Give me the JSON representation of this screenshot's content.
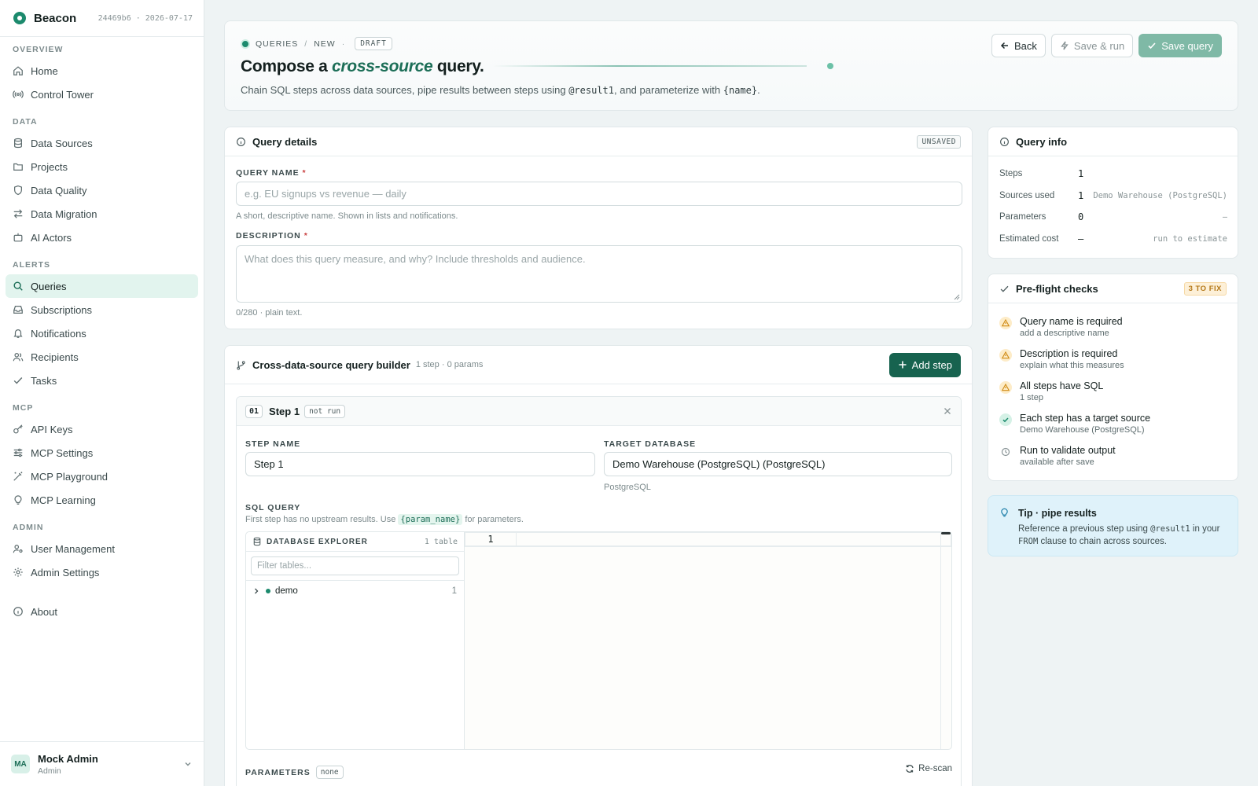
{
  "brand": {
    "name": "Beacon",
    "meta": "24469b6 · 2026-07-17"
  },
  "nav": {
    "sections": {
      "overview": "OVERVIEW",
      "data": "DATA",
      "alerts": "ALERTS",
      "mcp": "MCP",
      "admin": "ADMIN"
    },
    "items": {
      "home": "Home",
      "control_tower": "Control Tower",
      "data_sources": "Data Sources",
      "projects": "Projects",
      "data_quality": "Data Quality",
      "data_migration": "Data Migration",
      "ai_actors": "AI Actors",
      "queries": "Queries",
      "subscriptions": "Subscriptions",
      "notifications": "Notifications",
      "recipients": "Recipients",
      "tasks": "Tasks",
      "api_keys": "API Keys",
      "mcp_settings": "MCP Settings",
      "mcp_playground": "MCP Playground",
      "mcp_learning": "MCP Learning",
      "user_management": "User Management",
      "admin_settings": "Admin Settings",
      "about": "About"
    }
  },
  "user": {
    "initials": "MA",
    "name": "Mock Admin",
    "role": "Admin"
  },
  "hero": {
    "crumb_queries": "QUERIES",
    "crumb_sep": "/",
    "crumb_new": "NEW",
    "crumb_dot": "·",
    "crumb_draft": "DRAFT",
    "title_prefix": "Compose a",
    "title_em": "cross-source",
    "title_suffix": "query.",
    "sub_1": "Chain SQL steps across data sources, pipe results between steps using",
    "sub_code_1": "@result1",
    "sub_2": ", and parameterize with",
    "sub_code_2": "{name}",
    "sub_3": ".",
    "back": "Back",
    "save_run": "Save & run",
    "save_query": "Save query"
  },
  "details": {
    "title": "Query details",
    "badge": "UNSAVED",
    "name_label": "QUERY NAME",
    "required": "*",
    "name_placeholder": "e.g. EU signups vs revenue — daily",
    "name_hint": "A short, descriptive name. Shown in lists and notifications.",
    "desc_label": "DESCRIPTION",
    "desc_placeholder": "What does this query measure, and why? Include thresholds and audience.",
    "desc_hint": "0/280 · plain text."
  },
  "builder": {
    "title": "Cross-data-source query builder",
    "meta": "1 step · 0 params",
    "add_step": "Add step",
    "step": {
      "num": "01",
      "title": "Step 1",
      "status": "not run",
      "name_label": "STEP NAME",
      "name_value": "Step 1",
      "db_label": "TARGET DATABASE",
      "db_value": "Demo Warehouse (PostgreSQL) (PostgreSQL)",
      "db_hint": "PostgreSQL",
      "sql_label": "SQL QUERY",
      "sql_hint_1": "First step has no upstream results. Use",
      "sql_hint_code": "{param_name}",
      "sql_hint_2": "for parameters.",
      "explorer_title": "DATABASE EXPLORER",
      "explorer_count": "1 table",
      "filter_placeholder": "Filter tables...",
      "tree": [
        {
          "name": "demo",
          "count": "1"
        }
      ],
      "line_number": "1",
      "params_label": "PARAMETERS",
      "params_badge": "none",
      "rescan": "Re-scan"
    }
  },
  "info": {
    "title": "Query info",
    "rows": [
      {
        "k": "Steps",
        "v": "1",
        "x": ""
      },
      {
        "k": "Sources used",
        "v": "1",
        "x": "Demo Warehouse (PostgreSQL)"
      },
      {
        "k": "Parameters",
        "v": "0",
        "x": "—"
      },
      {
        "k": "Estimated cost",
        "v": "—",
        "x": "run to estimate"
      }
    ]
  },
  "checks": {
    "title": "Pre-flight checks",
    "badge": "3 TO FIX",
    "items": [
      {
        "status": "warn",
        "title": "Query name is required",
        "sub": "add a descriptive name"
      },
      {
        "status": "warn",
        "title": "Description is required",
        "sub": "explain what this measures"
      },
      {
        "status": "warn",
        "title": "All steps have SQL",
        "sub": "1 step"
      },
      {
        "status": "ok",
        "title": "Each step has a target source",
        "sub": "Demo Warehouse (PostgreSQL)"
      },
      {
        "status": "pending",
        "title": "Run to validate output",
        "sub": "available after save"
      }
    ]
  },
  "tip": {
    "title": "Tip · pipe results",
    "body_1": "Reference a previous step using",
    "body_code_1": "@result1",
    "body_2": "in your",
    "body_code_2": "FROM",
    "body_3": "clause to chain across sources."
  },
  "colors": {
    "accent": "#17634f",
    "brand": "#1c8a6d",
    "warn": "#d08b14",
    "tip_bg": "#dff2fa"
  }
}
